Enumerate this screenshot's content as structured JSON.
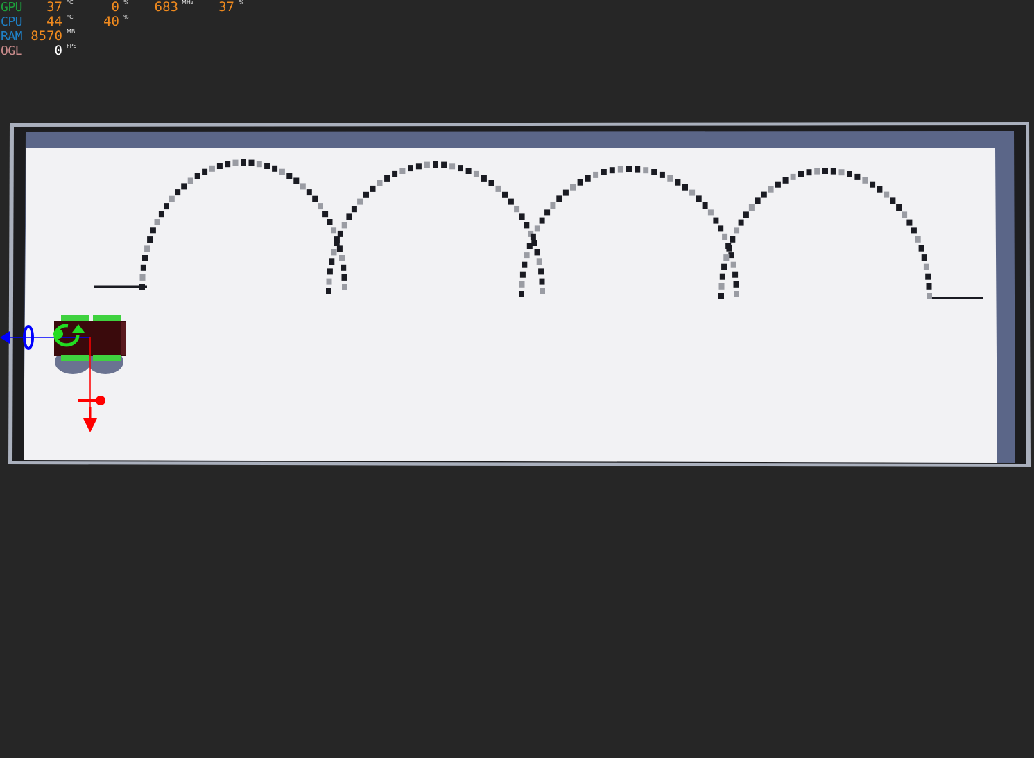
{
  "overlay": {
    "rows": [
      {
        "label": "GPU",
        "label_color": "#1e9e3c",
        "values": [
          {
            "value": "37",
            "unit": "°C"
          },
          {
            "value": "0",
            "unit": "%"
          },
          {
            "value": "683",
            "unit": "MHz"
          },
          {
            "value": "37",
            "unit": "%"
          }
        ]
      },
      {
        "label": "CPU",
        "label_color": "#1f7fc4",
        "values": [
          {
            "value": "44",
            "unit": "°C"
          },
          {
            "value": "40",
            "unit": "%"
          }
        ]
      },
      {
        "label": "RAM",
        "label_color": "#1f7fc4",
        "values": [
          {
            "value": "8570",
            "unit": "MB"
          }
        ]
      },
      {
        "label": "OGL",
        "label_color": "#c98b8b",
        "values": [
          {
            "value": "0",
            "unit": "FPS",
            "value_color": "#ffffff"
          }
        ]
      }
    ]
  },
  "scene": {
    "track": {
      "color": "#1a1b22",
      "bumps": 4
    },
    "robot": {
      "body_color": "#3a0a0c",
      "wheel_color": "#3fd23f"
    },
    "gizmo": {
      "x_axis_color": "#0000ff",
      "y_axis_color": "#ff0000",
      "rotate_color": "#22dd22"
    },
    "arena": {
      "frame_color": "#5b6688",
      "floor_color": "#f2f2f4",
      "border_color": "#aab0bd"
    }
  }
}
